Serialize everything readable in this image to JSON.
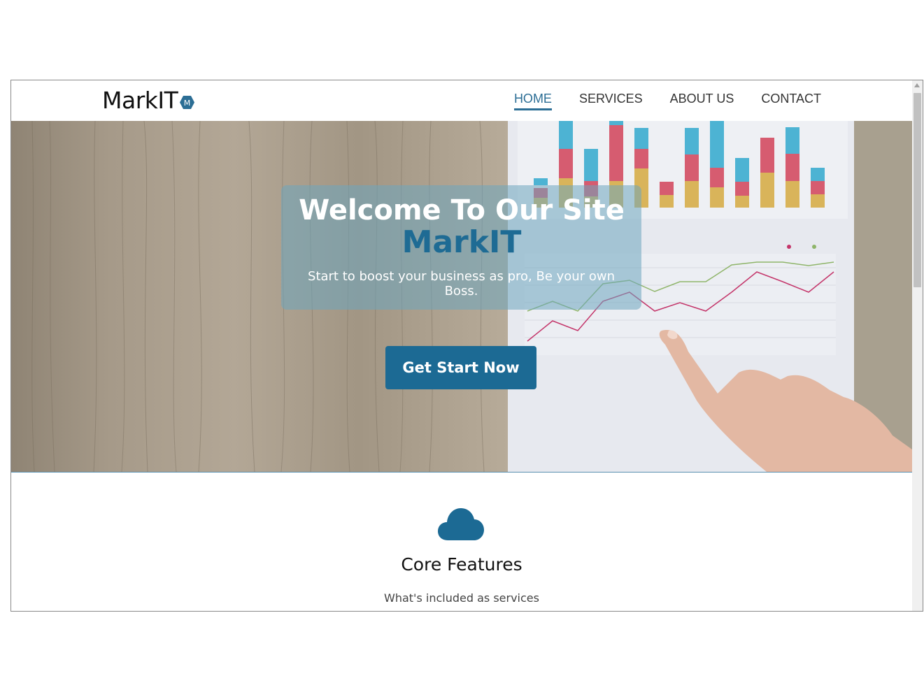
{
  "brand": {
    "name": "MarkIT",
    "badge_letter": "M"
  },
  "nav": {
    "items": [
      {
        "label": "HOME",
        "active": true
      },
      {
        "label": "SERVICES",
        "active": false
      },
      {
        "label": "ABOUT US",
        "active": false
      },
      {
        "label": "CONTACT",
        "active": false
      }
    ]
  },
  "hero": {
    "title": "Welcome To Our Site",
    "subtitle": "MarkIT",
    "text": "Start to boost your business as pro, Be your own Boss.",
    "cta_label": "Get Start Now",
    "background_icon": "business-chart-photo"
  },
  "features": {
    "icon": "cloud-icon",
    "title": "Core Features",
    "subtitle": "What's included as services"
  },
  "colors": {
    "accent": "#1c6a94",
    "nav_active": "#2c6e95"
  }
}
